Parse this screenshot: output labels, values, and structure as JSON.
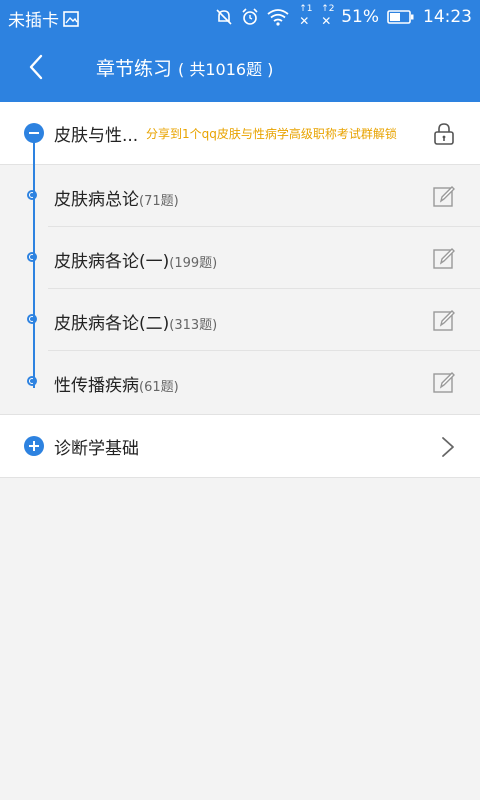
{
  "status_bar": {
    "carrier": "未插卡",
    "battery_percent": "51%",
    "time": "14:23",
    "sim1": "1",
    "sim2": "2"
  },
  "header": {
    "title": "章节练习",
    "count": "( 共1016题 )"
  },
  "groups": [
    {
      "title": "皮肤与性...",
      "tip": "分享到1个qq皮肤与性病学高级职称考试群解锁",
      "expanded": true,
      "items": [
        {
          "name": "皮肤病总论",
          "count": "(71题)"
        },
        {
          "name": "皮肤病各论(一)",
          "count": "(199题)"
        },
        {
          "name": "皮肤病各论(二)",
          "count": "(313题)"
        },
        {
          "name": "性传播疾病",
          "count": "(61题)"
        }
      ]
    },
    {
      "title": "诊断学基础",
      "expanded": false
    }
  ],
  "colors": {
    "accent": "#2d82e0",
    "tip": "#e8a300",
    "background": "#f3f3f3"
  }
}
